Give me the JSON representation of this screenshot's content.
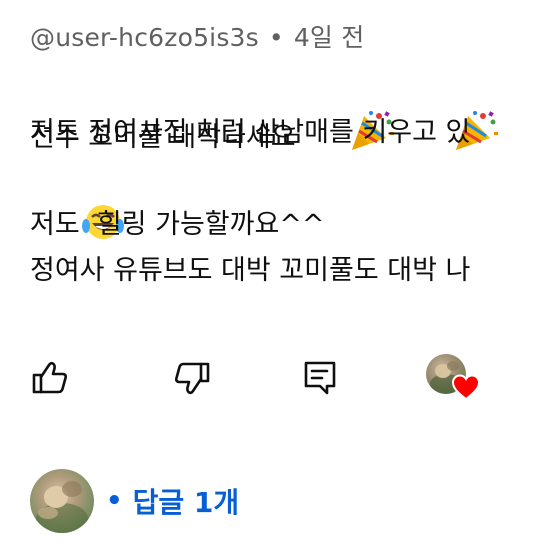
{
  "comment": {
    "author": "@user-hc6zo5is3s",
    "separator": "•",
    "time": "4일 전",
    "lines": [
      "전주 꼬미풀 대박나세요",
      "저도 정여사집 처럼 삼남매를 키우고 있",
      "",
      "저도  힐링 가능할까요^^",
      "정여사 유튜브도 대박 꼬미풀도 대박 나"
    ],
    "line_emojis": [
      [
        "party-popper-icon",
        "party-popper-icon"
      ],
      [],
      [
        "laughing-tears-icon"
      ],
      [],
      []
    ]
  },
  "actions": {
    "like_icon": "thumbs-up-icon",
    "dislike_icon": "thumbs-down-icon",
    "reply_icon": "reply-comment-icon",
    "creator_heart_icon": "heart-icon",
    "heart_color": "#ff0000"
  },
  "replies": {
    "bullet": "•",
    "label": "답글 1개",
    "link_color": "#065fd4"
  }
}
